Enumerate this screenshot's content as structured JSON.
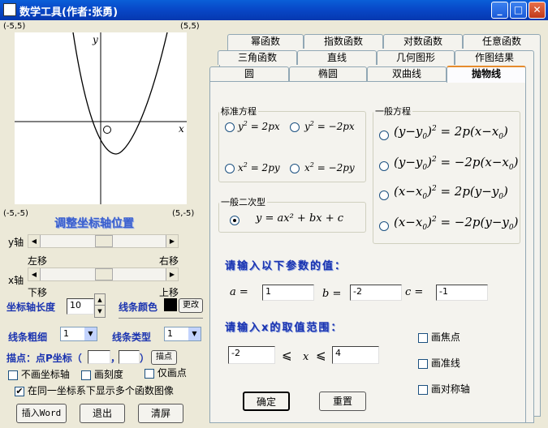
{
  "window": {
    "title": "数学工具(作者:张勇)",
    "minimize": "_",
    "maximize": "□",
    "close": "✕"
  },
  "graph": {
    "corner_tl": "(-5,5)",
    "corner_tr": "(5,5)",
    "corner_bl": "(-5,-5)",
    "corner_br": "(5,-5)",
    "y_axis_label": "y",
    "x_axis_label": "x"
  },
  "axis_controls": {
    "title": "调整坐标轴位置",
    "y_label": "y轴",
    "x_label": "x轴",
    "left_move": "左移",
    "right_move": "右移",
    "down_move": "下移",
    "up_move": "上移",
    "length_label": "坐标轴长度",
    "length_value": "10",
    "color_label": "线条颜色",
    "color_value": "#000000",
    "change_button": "更改"
  },
  "line_controls": {
    "width_label": "线条粗细",
    "width_value": "1",
    "type_label": "线条类型",
    "type_value": "1"
  },
  "plot_point": {
    "label": "描点：点P坐标（",
    "comma": "，",
    "close_paren": "）",
    "x_value": "",
    "y_value": "",
    "button": "描点"
  },
  "options": {
    "no_axis": "不画坐标轴",
    "draw_ticks": "画刻度",
    "points_only": "仅画点",
    "multi_function": "在同一坐标系下显示多个函数图像",
    "multi_function_checked": true
  },
  "bottom_buttons": {
    "insert_word": "插入Word",
    "exit": "退出",
    "clear": "清屏"
  },
  "tabs": {
    "row1": [
      "幂函数",
      "指数函数",
      "对数函数",
      "任意函数"
    ],
    "row2": [
      "三角函数",
      "直线",
      "几何图形",
      "作图结果"
    ],
    "row3": [
      "圆",
      "椭圆",
      "双曲线",
      "抛物线"
    ],
    "active": "抛物线"
  },
  "parabola": {
    "standard_legend": "标准方程",
    "general_legend": "一般方程",
    "quadratic_legend": "一般二次型",
    "quadratic_formula": "y = ax² + bx + c",
    "params_title": "请输入以下参数的值：",
    "a_label": "a =",
    "a_value": "1",
    "b_label": "b =",
    "b_value": "-2",
    "c_label": "c =",
    "c_value": "-1",
    "range_title": "请输入x的取值范围：",
    "x_min": "-2",
    "x_max": "4",
    "leq": "⩽",
    "x_var": "x",
    "draw_focus": "画焦点",
    "draw_directrix": "画准线",
    "draw_symmetry_axis": "画对称轴",
    "ok_button": "确定",
    "reset_button": "重置"
  }
}
